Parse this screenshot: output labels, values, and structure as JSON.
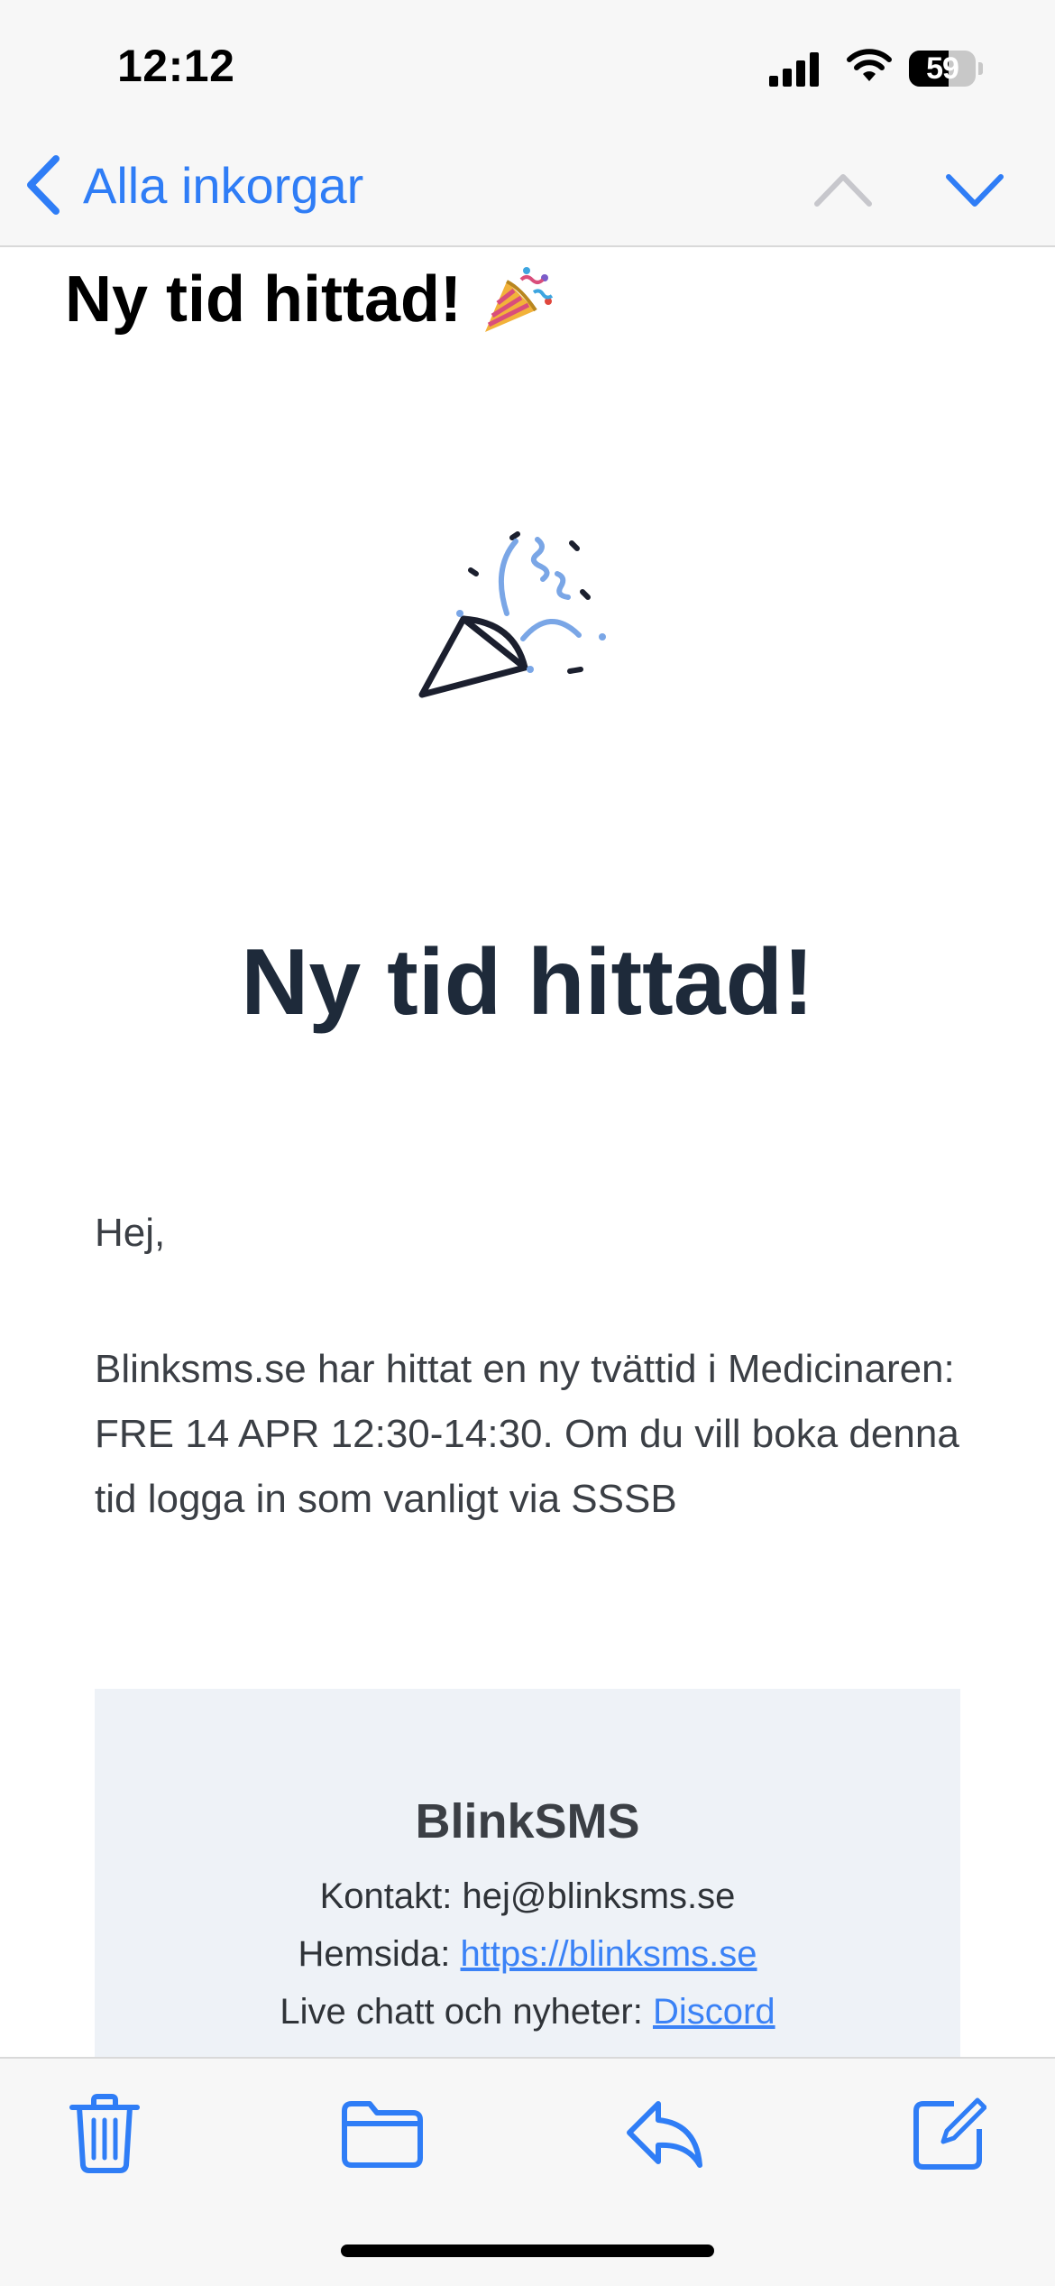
{
  "status_bar": {
    "time": "12:12",
    "battery": "59"
  },
  "nav": {
    "back_label": "Alla inkorgar",
    "icons": [
      "chevron-left-icon",
      "chevron-up-icon",
      "chevron-down-icon"
    ]
  },
  "email": {
    "subject": "Ny tid hittad!",
    "subject_emoji": "🎉",
    "headline": "Ny tid hittad!",
    "greeting": "Hej,",
    "body": "Blinksms.se har hittat en ny tvättid i Medicinaren: FRE 14 APR 12:30-14:30. Om du vill boka denna tid logga in som vanligt via SSSB",
    "footer": {
      "title": "BlinkSMS",
      "contact_text": "Kontakt: hej@blinksms.se",
      "website_label": "Hemsida: ",
      "website_link": "https://blinksms.se",
      "chat_label": "Live chatt och nyheter: ",
      "chat_link": "Discord"
    }
  },
  "toolbar": {
    "icons": [
      "trash-icon",
      "folder-icon",
      "reply-icon",
      "compose-icon"
    ]
  },
  "colors": {
    "accent": "#2f7df6",
    "headline": "#1e2a3a",
    "body_text": "#3b3f45",
    "card_bg": "#eef2f7"
  }
}
